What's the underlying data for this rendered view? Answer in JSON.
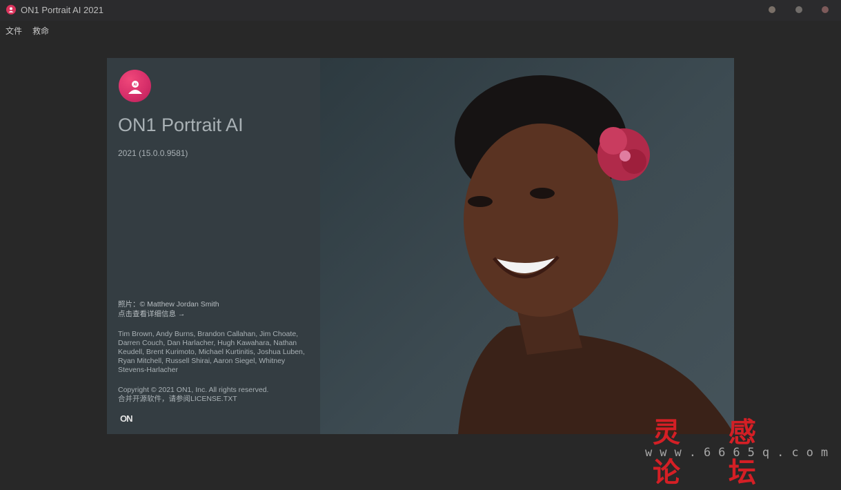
{
  "window": {
    "title": "ON1 Portrait AI 2021"
  },
  "menu": {
    "file": "文件",
    "help": "救命"
  },
  "about": {
    "product_name": "ON1 Portrait AI",
    "version": "2021 (15.0.0.9581)",
    "photo_credit": "照片：© Matthew Jordan Smith",
    "details_link": "点击查看详细信息 →",
    "team": "Tim Brown, Andy Burns, Brandon Callahan, Jim Choate, Darren Couch, Dan Harlacher, Hugh Kawahara, Nathan Keudell, Brent Kurimoto, Michael Kurtinitis, Joshua Luben, Ryan Mitchell, Russell Shirai, Aaron Siegel, Whitney Stevens-Harlacher",
    "copyright": "Copyright © 2021 ON1, Inc. All rights reserved.",
    "license": "合并开源软件，请参阅LICENSE.TXT",
    "brand_mark": "ON"
  },
  "watermark": {
    "chinese": "灵 感 论 坛",
    "url": "www.6665q.com"
  },
  "colors": {
    "accent": "#d9335c",
    "panel": "#343d42",
    "background": "#282828"
  },
  "icons": {
    "app": "portrait-ai-icon",
    "logo": "portrait-ai-logo"
  }
}
